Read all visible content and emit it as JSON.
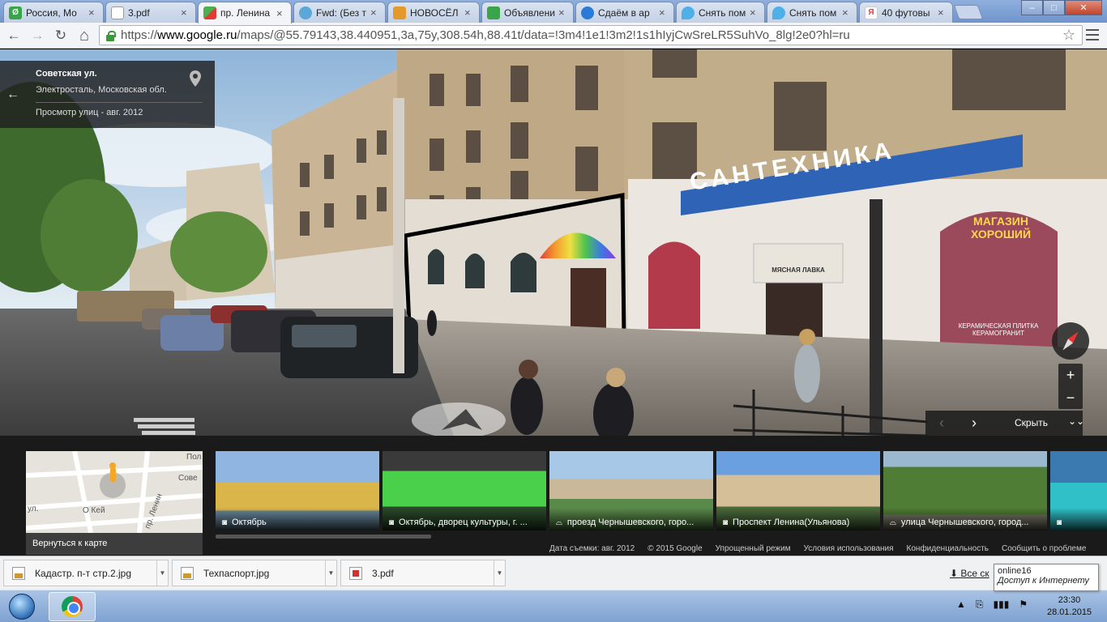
{
  "tabs": [
    {
      "title": "Россия, Мо",
      "favicon": "#3aa44a",
      "glyph": "Ø",
      "active": false
    },
    {
      "title": "3.pdf",
      "favicon": "#ffffff",
      "glyph": "",
      "active": false
    },
    {
      "title": "пр. Ленина",
      "favicon": "#4a8f3a",
      "glyph": "",
      "active": true
    },
    {
      "title": "Fwd: (Без т",
      "favicon": "#5aa7d8",
      "glyph": "",
      "active": false
    },
    {
      "title": "НОВОСЁЛ",
      "favicon": "#e39a2a",
      "glyph": "",
      "active": false
    },
    {
      "title": "Объявлени",
      "favicon": "#3aa44a",
      "glyph": "",
      "active": false
    },
    {
      "title": "Сдаём в ар",
      "favicon": "#2a7bd8",
      "glyph": "",
      "active": false
    },
    {
      "title": "Снять пом",
      "favicon": "#4fb0e8",
      "glyph": "",
      "active": false
    },
    {
      "title": "Снять пом",
      "favicon": "#4fb0e8",
      "glyph": "",
      "active": false
    },
    {
      "title": "40 футовы",
      "favicon": "#e83a3a",
      "glyph": "Я",
      "active": false
    }
  ],
  "window_controls": {
    "minimize": "–",
    "maximize": "□",
    "close": "✕"
  },
  "nav": {
    "back": "←",
    "forward": "→",
    "reload": "↻",
    "home": "⌂"
  },
  "address": {
    "scheme": "https://",
    "host": "www.google.ru",
    "rest": "/maps/@55.79143,38.440951,3a,75y,308.54h,88.41t/data=!3m4!1e1!3m2!1s1hIyjCwSreLR5SuhVo_8lg!2e0?hl=ru"
  },
  "bookmark_icon": "☆",
  "location_card": {
    "back_icon": "←",
    "title": "Советская ул.",
    "subtitle": "Электросталь, Московская обл.",
    "date": "Просмотр улиц - авг. 2012"
  },
  "scene_signs": {
    "store_sign": "САНТЕХНИКА",
    "window_sign": "МАГАЗИН ХОРОШИЙ",
    "window_sub": "КЕРАМИЧЕСКАЯ ПЛИТКА КЕРАМОГРАНИТ",
    "door_sign": "МЯСНАЯ ЛАВКА"
  },
  "controls": {
    "zoom_in": "+",
    "zoom_out": "−",
    "prev": "‹",
    "next": "›",
    "hide": "Скрыть",
    "collapse": "⌄⌄"
  },
  "minimap": {
    "back_label": "Вернуться к карте",
    "streets": [
      "ул.",
      "О Кей",
      "пр. Ленин",
      "Сове",
      "Пол"
    ]
  },
  "thumbnails": [
    {
      "caption": "Октябрь",
      "icon": "camera",
      "glyph": "◙"
    },
    {
      "caption": "Октябрь, дворец культуры, г. ...",
      "icon": "camera",
      "glyph": "◙"
    },
    {
      "caption": "проезд Чернышевского, горо...",
      "icon": "street-view",
      "glyph": "⌓"
    },
    {
      "caption": "Проспект Ленина(Ульянова)",
      "icon": "camera",
      "glyph": "◙"
    },
    {
      "caption": "улица Чернышевского, город...",
      "icon": "street-view",
      "glyph": "⌓"
    },
    {
      "caption": "",
      "icon": "camera",
      "glyph": "◙"
    }
  ],
  "footer_links": [
    "Дата съемки: авг. 2012",
    "© 2015 Google",
    "Упрощенный режим",
    "Условия использования",
    "Конфиденциальность",
    "Сообщить о проблеме"
  ],
  "downloads": [
    {
      "name": "Кадастр. п-т стр.2.jpg",
      "type": "jpg"
    },
    {
      "name": "Техпаспорт.jpg",
      "type": "jpg"
    },
    {
      "name": "3.pdf",
      "type": "pdf"
    }
  ],
  "all_downloads": "Все ск",
  "tooltip": {
    "line1": "online16",
    "line2": "Доступ к Интернету"
  },
  "clock": {
    "time": "23:30",
    "date": "28.01.2015"
  },
  "tray_icons": [
    "▲",
    "⎘",
    "▮▮▮",
    "⚑"
  ]
}
